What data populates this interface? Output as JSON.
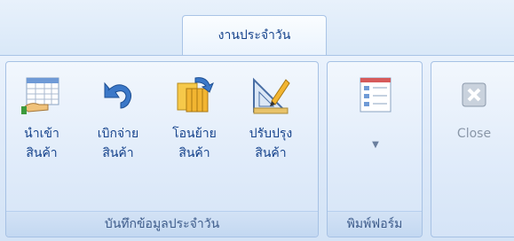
{
  "tab": {
    "label": "งานประจำวัน"
  },
  "group_daily": {
    "label": "บันทึกข้อมูลประจำวัน",
    "buttons": [
      {
        "line1": "นำเข้า",
        "line2": "สินค้า",
        "icon": "import-goods-icon"
      },
      {
        "line1": "เบิกจ่าย",
        "line2": "สินค้า",
        "icon": "undo-arrow-icon"
      },
      {
        "line1": "โอนย้าย",
        "line2": "สินค้า",
        "icon": "transfer-goods-icon"
      },
      {
        "line1": "ปรับปรุง",
        "line2": "สินค้า",
        "icon": "adjust-goods-icon"
      }
    ]
  },
  "group_forms": {
    "label": "พิมพ์ฟอร์ม",
    "dropdown_glyph": "▼",
    "icon": "form-list-icon"
  },
  "group_close": {
    "label": "Close",
    "icon": "close-icon"
  }
}
